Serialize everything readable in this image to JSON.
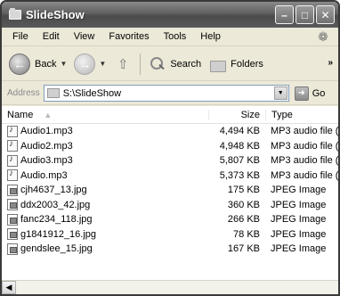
{
  "window": {
    "title": "SlideShow"
  },
  "menu": {
    "items": [
      {
        "label": "File"
      },
      {
        "label": "Edit"
      },
      {
        "label": "View"
      },
      {
        "label": "Favorites"
      },
      {
        "label": "Tools"
      },
      {
        "label": "Help"
      }
    ]
  },
  "toolbar": {
    "back_label": "Back",
    "search_label": "Search",
    "folders_label": "Folders",
    "chevron": "»"
  },
  "address": {
    "label": "Address",
    "value": "S:\\SlideShow",
    "go_label": "Go"
  },
  "list": {
    "headers": {
      "name": "Name",
      "size": "Size",
      "type": "Type"
    },
    "rows": [
      {
        "name": "Audio1.mp3",
        "size": "4,494 KB",
        "type": "MP3 audio file (",
        "icon": "audio-file-icon"
      },
      {
        "name": "Audio2.mp3",
        "size": "4,948 KB",
        "type": "MP3 audio file (",
        "icon": "audio-file-icon"
      },
      {
        "name": "Audio3.mp3",
        "size": "5,807 KB",
        "type": "MP3 audio file (",
        "icon": "audio-file-icon"
      },
      {
        "name": "Audio.mp3",
        "size": "5,373 KB",
        "type": "MP3 audio file (",
        "icon": "audio-file-icon"
      },
      {
        "name": "cjh4637_13.jpg",
        "size": "175 KB",
        "type": "JPEG Image",
        "icon": "image-file-icon"
      },
      {
        "name": "ddx2003_42.jpg",
        "size": "360 KB",
        "type": "JPEG Image",
        "icon": "image-file-icon"
      },
      {
        "name": "fanc234_118.jpg",
        "size": "266 KB",
        "type": "JPEG Image",
        "icon": "image-file-icon"
      },
      {
        "name": "g1841912_16.jpg",
        "size": "78 KB",
        "type": "JPEG Image",
        "icon": "image-file-icon"
      },
      {
        "name": "gendslee_15.jpg",
        "size": "167 KB",
        "type": "JPEG Image",
        "icon": "image-file-icon"
      }
    ]
  }
}
